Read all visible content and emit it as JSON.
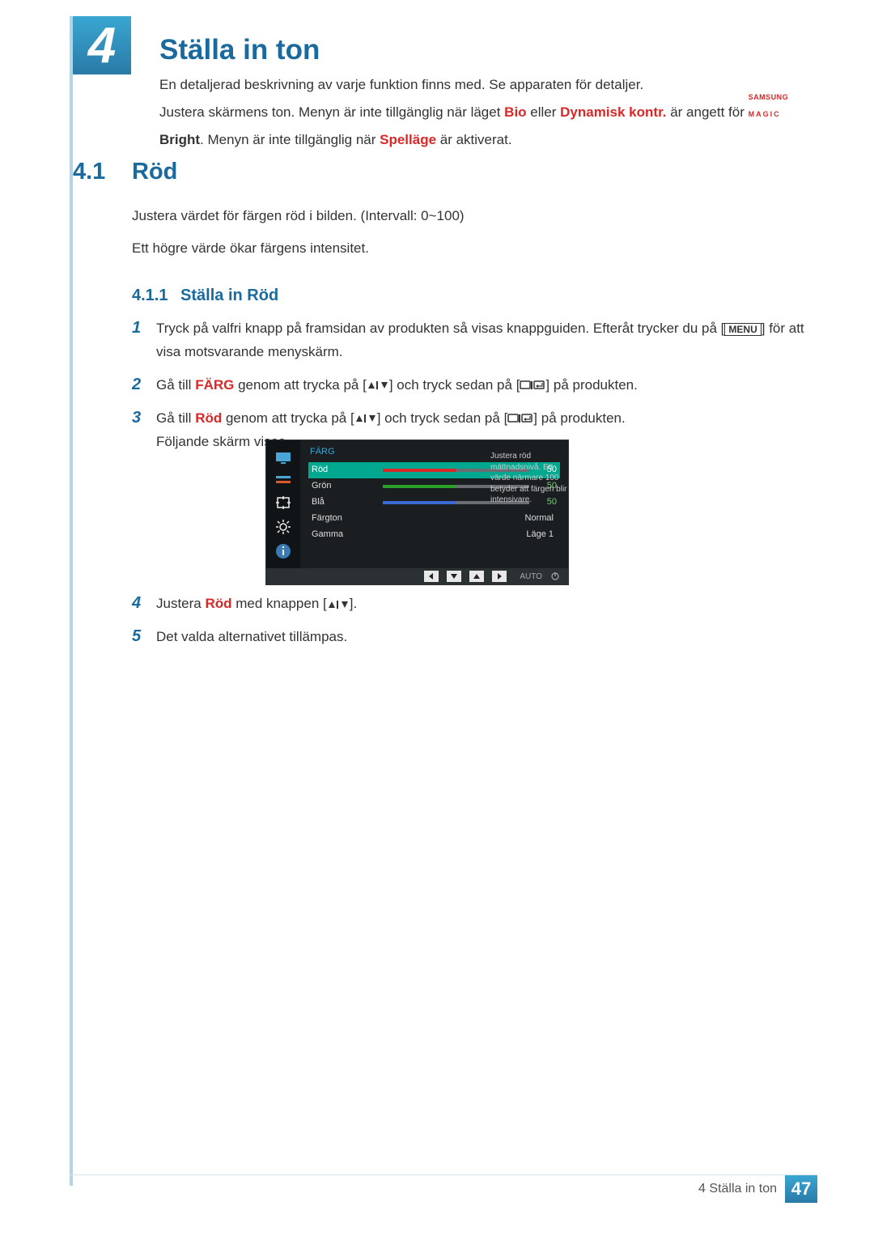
{
  "chapter": {
    "num": "4",
    "title": "Ställa in ton"
  },
  "intro": {
    "p1": "En detaljerad beskrivning av varje funktion finns med. Se apparaten för detaljer.",
    "p2a": "Justera skärmens ton. Menyn är inte tillgänglig när läget ",
    "bio": "Bio",
    "eller": " eller ",
    "dyn": "Dynamisk kontr.",
    "p2b": " är angett för ",
    "magic_top": "SAMSUNG",
    "magic_bot": "MAGIC",
    "bright": "Bright",
    "p2c": ". Menyn är inte tillgänglig när ",
    "spel": "Spelläge",
    "p2d": " är aktiverat."
  },
  "section": {
    "num": "4.1",
    "title": "Röd"
  },
  "para1": "Justera värdet för färgen röd i bilden. (Intervall: 0~100)",
  "para2": "Ett högre värde ökar färgens intensitet.",
  "subsection": {
    "num": "4.1.1",
    "title": "Ställa in Röd"
  },
  "steps": {
    "s1a": "Tryck på valfri knapp på framsidan av produkten så visas knappguiden. Efteråt trycker du på [",
    "s1_menu": "MENU",
    "s1b": "] för att visa motsvarande menyskärm.",
    "s2a": "Gå till ",
    "s2_farg": "FÄRG",
    "s2b": " genom att trycka på [",
    "s2c": "] och tryck sedan på [",
    "s2d": "] på produkten.",
    "s3a": "Gå till ",
    "s3_rod": "Röd",
    "s3b": " genom att trycka på [",
    "s3c": "] och tryck sedan på [",
    "s3d": "] på produkten.",
    "s3e": "Följande skärm visas.",
    "s4a": "Justera ",
    "s4_rod": "Röd",
    "s4b": " med knappen [",
    "s4c": "].",
    "s5": "Det valda alternativet tillämpas."
  },
  "osd": {
    "header": "FÄRG",
    "rows": [
      {
        "label": "Röd",
        "value": "50",
        "fill_pct": 50,
        "fill_color": "#d82828",
        "selected": true
      },
      {
        "label": "Grön",
        "value": "50",
        "fill_pct": 50,
        "fill_color": "#2aa02a",
        "selected": false
      },
      {
        "label": "Blå",
        "value": "50",
        "fill_pct": 50,
        "fill_color": "#3a6ad6",
        "selected": false
      }
    ],
    "textrows": [
      {
        "label": "Färgton",
        "value": "Normal"
      },
      {
        "label": "Gamma",
        "value": "Läge 1"
      }
    ],
    "help": "Justera röd mättnadsnivå. Ett värde närmare 100 betyder att färgen blir intensivare.",
    "auto": "AUTO"
  },
  "footer": {
    "text": "4 Ställa in ton",
    "page": "47"
  }
}
